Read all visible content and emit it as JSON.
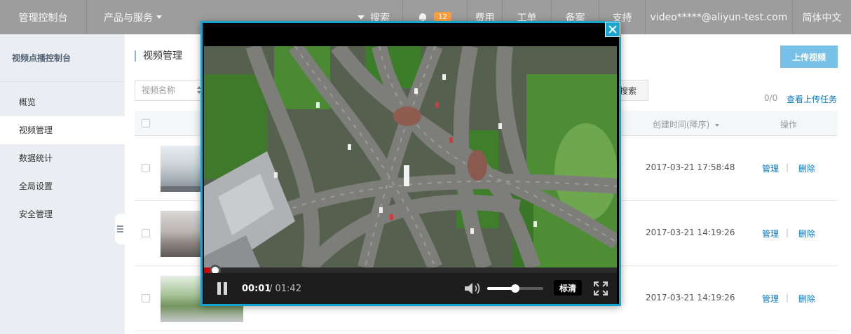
{
  "topbar": {
    "brand": "管理控制台",
    "products": "产品与服务",
    "search": "搜索",
    "notification_count": "12",
    "cost": "费用",
    "ticket": "工单",
    "record": "备案",
    "support": "支持",
    "user": "video*****@aliyun-test.com",
    "language": "简体中文"
  },
  "sidebar": {
    "title": "视频点播控制台",
    "items": [
      {
        "label": "概览"
      },
      {
        "label": "视频管理"
      },
      {
        "label": "数据统计"
      },
      {
        "label": "全局设置"
      },
      {
        "label": "安全管理"
      }
    ],
    "active_index": 1
  },
  "main": {
    "page_title": "视频管理",
    "upload_button": "上传视频",
    "filter_select": "视频名称",
    "search_button": "搜索",
    "upload_count": "0/0",
    "view_upload_tasks": "查看上传任务",
    "table": {
      "col_created": "创建时间(降序)",
      "col_actions": "操作",
      "rows": [
        {
          "created": "2017-03-21 17:58:48",
          "manage": "管理",
          "sep": "|",
          "delete": "删除"
        },
        {
          "created": "2017-03-21 14:19:26",
          "manage": "管理",
          "sep": "|",
          "delete": "删除"
        },
        {
          "created": "2017-03-21 14:19:26",
          "manage": "管理",
          "sep": "|",
          "delete": "删除"
        }
      ]
    }
  },
  "player": {
    "time_current": "00:01",
    "time_total": "/ 01:42",
    "quality": "标清",
    "progress_fraction": 0.0098,
    "volume_fraction": 0.5,
    "accent_color": "#13a3cf",
    "progress_color": "#cc0000"
  }
}
